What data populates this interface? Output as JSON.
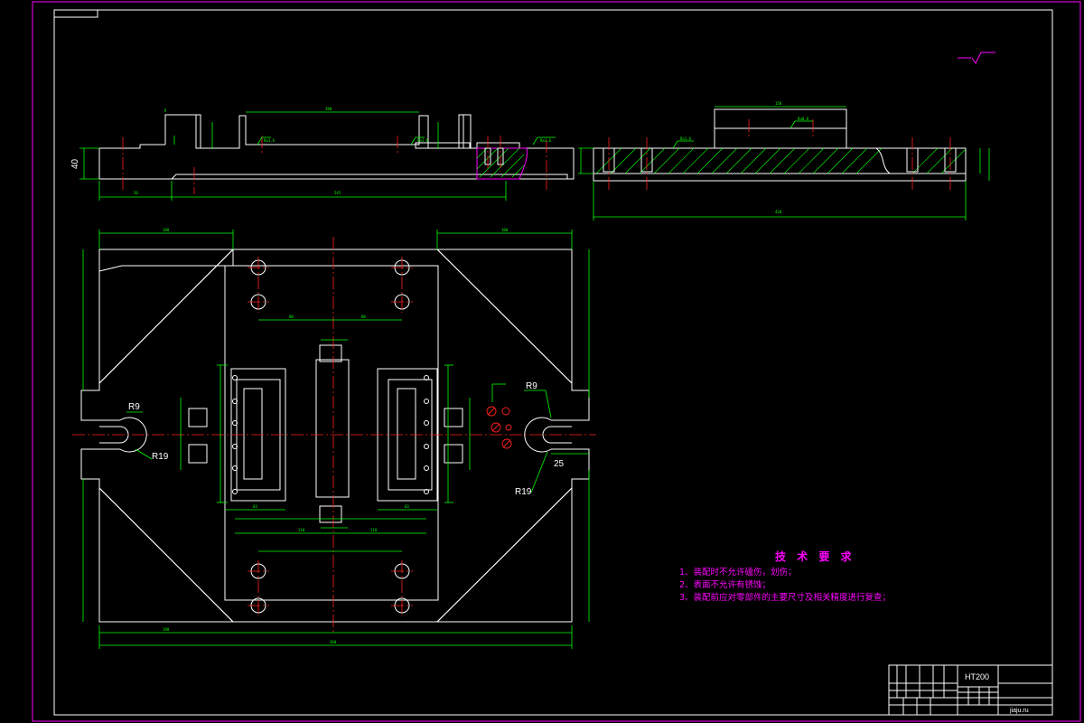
{
  "frame": {
    "border_color": "#ff00ff",
    "line_color": "#ffffff",
    "dimension_color": "#00ff00",
    "centerline_color": "#ff2020",
    "text_color": "#ff00ff"
  },
  "plan_view": {
    "radius_labels": [
      "R9",
      "R9",
      "R19",
      "R19"
    ],
    "dimension_25": "25"
  },
  "side_view": {
    "height_dim": "40"
  },
  "technical_requirements": {
    "title": "技 术 要 求",
    "items": [
      "1、装配时不允许磕伤，划伤；",
      "2、表面不允许有锈蚀；",
      "3、装配前应对零部件的主要尺寸及相关精度进行复查；"
    ]
  },
  "title_block": {
    "material": "HT200",
    "drawing_name": "jiaju.ru"
  }
}
